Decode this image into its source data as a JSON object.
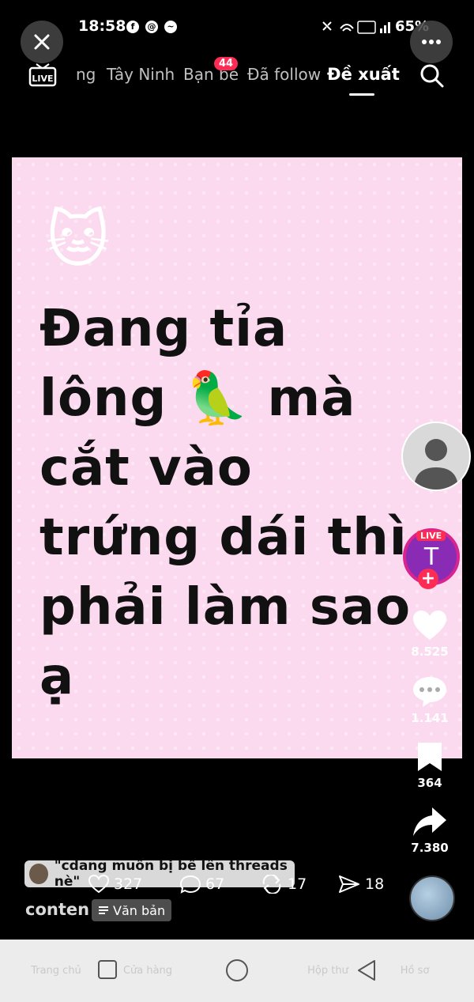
{
  "status_bar": {
    "time": "18:58",
    "battery": "65%",
    "app_icons": [
      "facebook-icon",
      "threads-icon",
      "messenger-icon"
    ]
  },
  "top_nav": {
    "items": [
      "ng",
      "Tây Ninh",
      "Bạn bè",
      "Đã follow",
      "Đề xuất"
    ],
    "badge": "44",
    "active": "Đề xuất"
  },
  "card": {
    "emoji": "🐱",
    "lines": [
      "Đang tỉa",
      "lông 🦜 mà",
      "cắt vào",
      "trứng dái thì",
      "phải làm sao",
      "ạ"
    ],
    "background_color": "#fbdaf0"
  },
  "actions": {
    "live_tag": "LIVE",
    "live_initial": "T",
    "likes": "8.525",
    "comments": "1.141",
    "saves": "364",
    "shares": "7.380"
  },
  "threads": {
    "quote": "\"cdang muốn bị bế lên threads nè\"",
    "stats": {
      "likes": "327",
      "comments": "67",
      "reposts": "17",
      "sends": "18"
    }
  },
  "author": {
    "username": "conten",
    "chip_label": "Văn bản"
  },
  "bottom_tabs": [
    "Trang chủ",
    "Cửa hàng",
    "",
    "Hộp thư",
    "Hồ sơ"
  ]
}
